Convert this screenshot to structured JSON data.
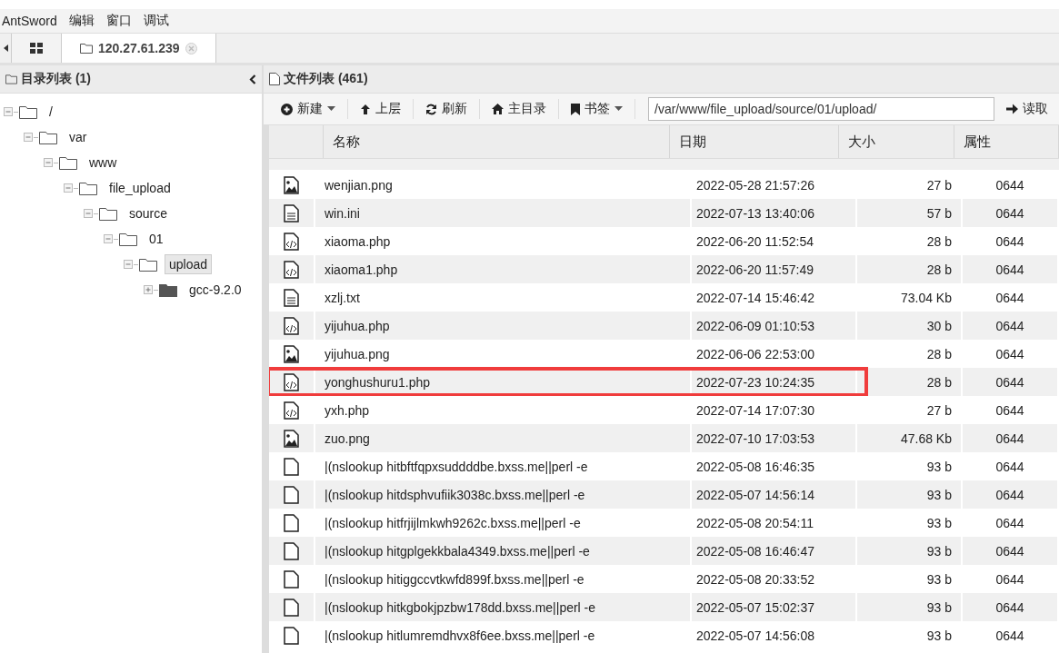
{
  "menu": [
    "AntSword",
    "编辑",
    "窗口",
    "调试"
  ],
  "tabs": [
    {
      "kind": "grid",
      "selected": false
    },
    {
      "kind": "host",
      "label": "120.27.61.239",
      "selected": true
    }
  ],
  "dir_panel": {
    "title": "目录列表 (1)",
    "tree": [
      {
        "name": "/",
        "expanded": true,
        "selected": false,
        "children": [
          {
            "name": "var",
            "expanded": true,
            "selected": false,
            "children": [
              {
                "name": "www",
                "expanded": true,
                "selected": false,
                "children": [
                  {
                    "name": "file_upload",
                    "expanded": true,
                    "selected": false,
                    "children": [
                      {
                        "name": "source",
                        "expanded": true,
                        "selected": false,
                        "children": [
                          {
                            "name": "01",
                            "expanded": true,
                            "selected": false,
                            "children": [
                              {
                                "name": "upload",
                                "expanded": true,
                                "selected": true,
                                "children": [
                                  {
                                    "name": "gcc-9.2.0",
                                    "expanded": false,
                                    "selected": false
                                  }
                                ]
                              }
                            ]
                          }
                        ]
                      }
                    ]
                  }
                ]
              }
            ]
          }
        ]
      }
    ]
  },
  "file_panel": {
    "title": "文件列表 (461)",
    "toolbar": [
      {
        "kind": "new",
        "label": "新建",
        "dropdown": true
      },
      {
        "kind": "up",
        "label": "上层",
        "dropdown": false
      },
      {
        "kind": "refresh",
        "label": "刷新",
        "dropdown": false
      },
      {
        "kind": "home",
        "label": "主目录",
        "dropdown": false
      },
      {
        "kind": "bookmark",
        "label": "书签",
        "dropdown": true
      }
    ],
    "path": "/var/www/file_upload/source/01/upload/",
    "read_button": "读取",
    "columns": [
      "名称",
      "日期",
      "大小",
      "属性"
    ],
    "rows": [
      {
        "kind": "image",
        "name": "wenjian.png",
        "date": "2022-05-28 21:57:26",
        "size": "27 b",
        "attr": "0644",
        "highlighted": false
      },
      {
        "kind": "text",
        "name": "win.ini",
        "date": "2022-07-13 13:40:06",
        "size": "57 b",
        "attr": "0644",
        "highlighted": false
      },
      {
        "kind": "code",
        "name": "xiaoma.php",
        "date": "2022-06-20 11:52:54",
        "size": "28 b",
        "attr": "0644",
        "highlighted": false
      },
      {
        "kind": "code",
        "name": "xiaoma1.php",
        "date": "2022-06-20 11:57:49",
        "size": "28 b",
        "attr": "0644",
        "highlighted": false
      },
      {
        "kind": "text",
        "name": "xzlj.txt",
        "date": "2022-07-14 15:46:42",
        "size": "73.04 Kb",
        "attr": "0644",
        "highlighted": false
      },
      {
        "kind": "code",
        "name": "yijuhua.php",
        "date": "2022-06-09 01:10:53",
        "size": "30 b",
        "attr": "0644",
        "highlighted": false
      },
      {
        "kind": "image",
        "name": "yijuhua.png",
        "date": "2022-06-06 22:53:00",
        "size": "28 b",
        "attr": "0644",
        "highlighted": false
      },
      {
        "kind": "code",
        "name": "yonghushuru1.php",
        "date": "2022-07-23 10:24:35",
        "size": "28 b",
        "attr": "0644",
        "highlighted": true
      },
      {
        "kind": "code",
        "name": "yxh.php",
        "date": "2022-07-14 17:07:30",
        "size": "27 b",
        "attr": "0644",
        "highlighted": false
      },
      {
        "kind": "image",
        "name": "zuo.png",
        "date": "2022-07-10 17:03:53",
        "size": "47.68 Kb",
        "attr": "0644",
        "highlighted": false
      },
      {
        "kind": "file",
        "name": "|(nslookup hitbftfqpxsuddddbe.bxss.me||perl -e",
        "date": "2022-05-08 16:46:35",
        "size": "93 b",
        "attr": "0644",
        "highlighted": false
      },
      {
        "kind": "file",
        "name": "|(nslookup hitdsphvufiik3038c.bxss.me||perl -e",
        "date": "2022-05-07 14:56:14",
        "size": "93 b",
        "attr": "0644",
        "highlighted": false
      },
      {
        "kind": "file",
        "name": "|(nslookup hitfrjijlmkwh9262c.bxss.me||perl -e",
        "date": "2022-05-08 20:54:11",
        "size": "93 b",
        "attr": "0644",
        "highlighted": false
      },
      {
        "kind": "file",
        "name": "|(nslookup hitgplgekkbala4349.bxss.me||perl -e",
        "date": "2022-05-08 16:46:47",
        "size": "93 b",
        "attr": "0644",
        "highlighted": false
      },
      {
        "kind": "file",
        "name": "|(nslookup hitiggccvtkwfd899f.bxss.me||perl -e",
        "date": "2022-05-08 20:33:52",
        "size": "93 b",
        "attr": "0644",
        "highlighted": false
      },
      {
        "kind": "file",
        "name": "|(nslookup hitkgbokjpzbw178dd.bxss.me||perl -e",
        "date": "2022-05-07 15:02:37",
        "size": "93 b",
        "attr": "0644",
        "highlighted": false
      },
      {
        "kind": "file",
        "name": "|(nslookup hitlumremdhvx8f6ee.bxss.me||perl -e",
        "date": "2022-05-07 14:56:08",
        "size": "93 b",
        "attr": "0644",
        "highlighted": false
      }
    ]
  }
}
